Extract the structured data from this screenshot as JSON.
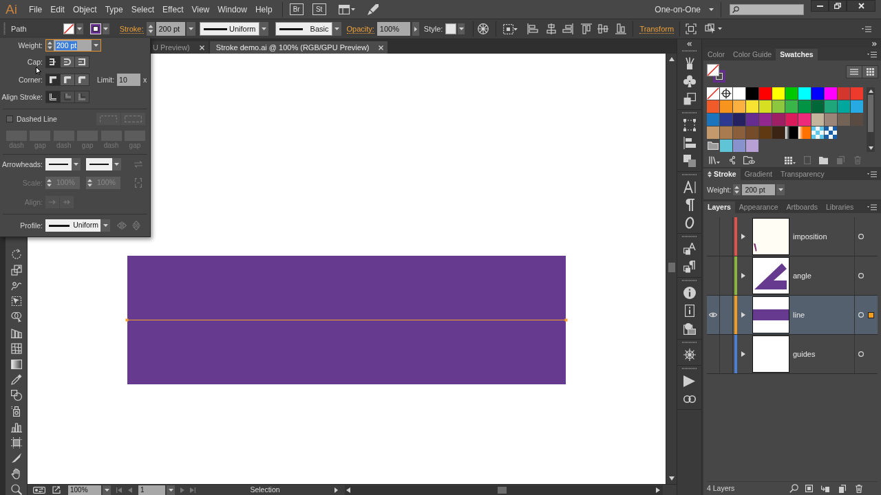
{
  "menu_bar": {
    "logo": "Ai",
    "menus": [
      "File",
      "Edit",
      "Object",
      "Type",
      "Select",
      "Effect",
      "View",
      "Window",
      "Help"
    ],
    "bridge": "Br",
    "stock": "St",
    "workspace": "One-on-One"
  },
  "control_bar": {
    "selection": "Path",
    "fill": {
      "kind": "none"
    },
    "stroke": {
      "kind": "color",
      "color": "#662d91"
    },
    "stroke_link": "Stroke:",
    "weight": "200 pt",
    "profile": "Uniform",
    "brush": "Basic",
    "opacity_link": "Opacity:",
    "opacity": "100%",
    "style_label": "Style:",
    "transform_link": "Transform"
  },
  "stroke_popup": {
    "weight_label": "Weight:",
    "weight": "200 pt",
    "weight_selected": true,
    "cap_label": "Cap:",
    "caps": [
      {
        "kind": "butt",
        "selected": true
      },
      {
        "kind": "round",
        "selected": false
      },
      {
        "kind": "projecting",
        "selected": false
      }
    ],
    "corner_label": "Corner:",
    "corners": [
      {
        "kind": "miter",
        "selected": true
      },
      {
        "kind": "round",
        "selected": false
      },
      {
        "kind": "bevel",
        "selected": false
      }
    ],
    "limit_label": "Limit:",
    "limit": "10",
    "limit_unit": "x",
    "align_label": "Align Stroke:",
    "aligns": [
      {
        "kind": "center",
        "selected": true,
        "disabled": false
      },
      {
        "kind": "inside",
        "selected": false,
        "disabled": true
      },
      {
        "kind": "outside",
        "selected": false,
        "disabled": true
      }
    ],
    "dashed": {
      "label": "Dashed Line",
      "checked": false
    },
    "dash_fields": [
      {
        "label": "dash"
      },
      {
        "label": "gap"
      },
      {
        "label": "dash"
      },
      {
        "label": "gap"
      },
      {
        "label": "dash"
      },
      {
        "label": "gap"
      }
    ],
    "arrowheads_label": "Arrowheads:",
    "scale": {
      "label": "Scale:",
      "start": "100%",
      "end": "100%",
      "disabled": true
    },
    "arrow_align": {
      "label": "Align:",
      "disabled": true
    },
    "profile_label": "Profile:",
    "profile": "Uniform"
  },
  "document_tabs": [
    {
      "title": "U Preview)",
      "selected": false
    },
    {
      "title": "Stroke demo.ai @ 100% (RGB/GPU Preview)",
      "selected": true
    }
  ],
  "status_bar": {
    "zoom": "100%",
    "artboard": "1",
    "status": "Selection"
  },
  "swatches_panel": {
    "tabs": [
      {
        "label": "Color",
        "selected": false
      },
      {
        "label": "Color Guide",
        "selected": false
      },
      {
        "label": "Swatches",
        "selected": true
      }
    ],
    "fill": {
      "kind": "none"
    },
    "stroke": {
      "kind": "color",
      "color": "#662d91"
    },
    "rows": [
      [
        {
          "kind": "none"
        },
        {
          "kind": "registration"
        },
        {
          "kind": "color",
          "color": "#ffffff"
        },
        {
          "kind": "color",
          "color": "#000000"
        },
        {
          "kind": "color",
          "color": "#ff0000"
        },
        {
          "kind": "color",
          "color": "#ffff00"
        },
        {
          "kind": "color",
          "color": "#00c800"
        },
        {
          "kind": "color",
          "color": "#00ffff"
        },
        {
          "kind": "color",
          "color": "#0000ff"
        },
        {
          "kind": "color",
          "color": "#ff00ff"
        },
        {
          "kind": "color",
          "color": "#d2362c"
        },
        {
          "kind": "color",
          "color": "#ed3a2d"
        }
      ],
      [
        {
          "kind": "color",
          "color": "#f15a29"
        },
        {
          "kind": "color",
          "color": "#f7941d"
        },
        {
          "kind": "color",
          "color": "#fbb040"
        },
        {
          "kind": "color",
          "color": "#f9e332"
        },
        {
          "kind": "color",
          "color": "#d7df23"
        },
        {
          "kind": "color",
          "color": "#8dc63f"
        },
        {
          "kind": "color",
          "color": "#39b54a"
        },
        {
          "kind": "color",
          "color": "#009444"
        },
        {
          "kind": "color",
          "color": "#006838"
        },
        {
          "kind": "color",
          "color": "#1fa67a"
        },
        {
          "kind": "color",
          "color": "#00a79d"
        },
        {
          "kind": "color",
          "color": "#27aae1"
        }
      ],
      [
        {
          "kind": "color",
          "color": "#1c75bc"
        },
        {
          "kind": "color",
          "color": "#2b3990"
        },
        {
          "kind": "color",
          "color": "#262262"
        },
        {
          "kind": "color",
          "color": "#662d91"
        },
        {
          "kind": "color",
          "color": "#92278f"
        },
        {
          "kind": "color",
          "color": "#9e1f63"
        },
        {
          "kind": "color",
          "color": "#da1c5c"
        },
        {
          "kind": "color",
          "color": "#ee2a7b"
        },
        {
          "kind": "color",
          "color": "#c2b59b"
        },
        {
          "kind": "color",
          "color": "#9b8579"
        },
        {
          "kind": "color",
          "color": "#736357"
        },
        {
          "kind": "color",
          "color": "#594a42"
        }
      ],
      [
        {
          "kind": "color",
          "color": "#c49a6c"
        },
        {
          "kind": "color",
          "color": "#a97c50"
        },
        {
          "kind": "color",
          "color": "#8b5e3c"
        },
        {
          "kind": "color",
          "color": "#754c29"
        },
        {
          "kind": "color",
          "color": "#603913"
        },
        {
          "kind": "color",
          "color": "#3c2415"
        },
        {
          "kind": "gradient",
          "color": "#000000"
        },
        {
          "kind": "gradient",
          "color": "#ff7200"
        },
        {
          "kind": "pattern",
          "color": "#5cc8ee"
        },
        {
          "kind": "pattern",
          "color": "#1a5ea8"
        }
      ],
      [
        {
          "kind": "group"
        },
        {
          "kind": "color",
          "color": "#5ec4d6"
        },
        {
          "kind": "color",
          "color": "#8892cc"
        },
        {
          "kind": "color",
          "color": "#b9a0d4"
        }
      ]
    ]
  },
  "stroke_panel": {
    "tabs": [
      {
        "label": "Stroke",
        "selected": true
      },
      {
        "label": "Gradient",
        "selected": false
      },
      {
        "label": "Transparency",
        "selected": false
      }
    ],
    "weight_label": "Weight:",
    "weight": "200 pt"
  },
  "layers_panel": {
    "tabs": [
      {
        "label": "Layers",
        "selected": true
      },
      {
        "label": "Appearance",
        "selected": false
      },
      {
        "label": "Artboards",
        "selected": false
      },
      {
        "label": "Libraries",
        "selected": false
      }
    ],
    "layers": [
      {
        "name": "imposition",
        "color": "#e2524a",
        "visible": false,
        "expanded": false,
        "thumbnail": {
          "kind": "corner-mark"
        },
        "selected": false,
        "selected_art": false
      },
      {
        "name": "angle",
        "color": "#8cb43a",
        "visible": false,
        "expanded": false,
        "thumbnail": {
          "kind": "angle"
        },
        "selected": false,
        "selected_art": false
      },
      {
        "name": "line",
        "color": "#f39c1f",
        "visible": true,
        "expanded": false,
        "thumbnail": {
          "kind": "band"
        },
        "selected": true,
        "selected_art": true
      },
      {
        "name": "guides",
        "color": "#4a7fd6",
        "visible": false,
        "expanded": false,
        "thumbnail": {
          "kind": "blank"
        },
        "selected": false,
        "selected_art": false
      }
    ],
    "count": "4 Layers"
  }
}
